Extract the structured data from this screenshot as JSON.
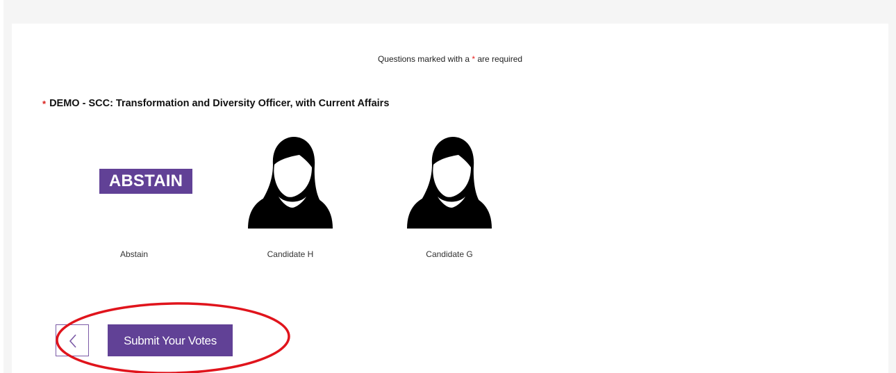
{
  "form": {
    "required_note_prefix": "Questions marked with a ",
    "required_note_star": "*",
    "required_note_suffix": " are required",
    "question": {
      "star": "*",
      "title": "DEMO - SCC: Transformation and Diversity Officer, with Current Affairs"
    },
    "candidates": [
      {
        "name": "Abstain",
        "badge_text": "ABSTAIN",
        "icon": "abstain-badge"
      },
      {
        "name": "Candidate H",
        "icon": "female-avatar-icon"
      },
      {
        "name": "Candidate G",
        "icon": "female-avatar-icon"
      }
    ]
  },
  "actions": {
    "back_icon": "chevron-left-icon",
    "submit_label": "Submit Your Votes"
  },
  "colors": {
    "brand_purple": "#614196",
    "required_red": "#e8231f",
    "annotation_red": "#e0141c"
  }
}
